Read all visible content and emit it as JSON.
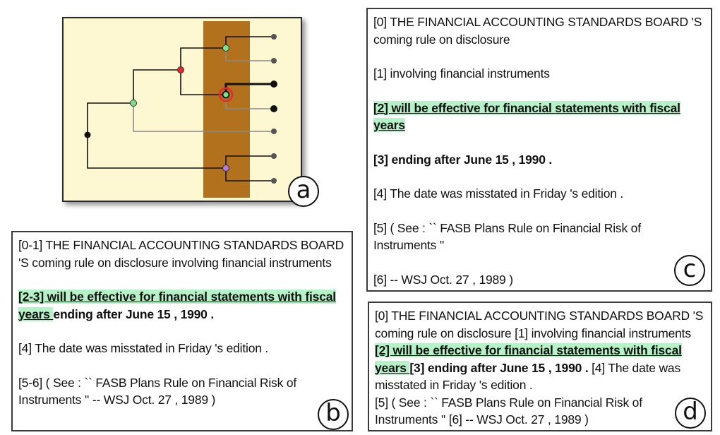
{
  "labels": {
    "a": "a",
    "b": "b",
    "c": "c",
    "d": "d"
  },
  "colors": {
    "panel_bg": "#fdf8d2",
    "band": "#b2711c",
    "highlight": "#b6f2c7",
    "node_red": "#e8262e",
    "node_green": "#7fe08a",
    "node_purple": "#b57ad6",
    "node_black": "#111111",
    "leaf_gray": "#555555"
  },
  "panel_b": {
    "s1": "[0-1] THE FINANCIAL ACCOUNTING STANDARDS BOARD 'S coming rule on disclosure  involving financial instruments",
    "s2_hl": "[2-3] will be effective for financial statements with fiscal years ",
    "s2_rest": "ending after June 15 , 1990 .",
    "s3": "[4] The date was misstated in Friday 's edition .",
    "s4": "[5-6] ( See : `` FASB Plans Rule on Financial Risk of Instruments '' -- WSJ Oct. 27 , 1989 )"
  },
  "panel_c": {
    "s0": "[0] THE FINANCIAL ACCOUNTING STANDARDS BOARD 'S coming rule on disclosure",
    "s1": "[1] involving financial instruments",
    "s2": "[2] will be effective for financial statements with fiscal years",
    "s3": "[3] ending after June 15 , 1990 .",
    "s4": "[4] The date was misstated in Friday 's edition .",
    "s5": "[5] ( See : `` FASB Plans Rule on Financial Risk of Instruments ''",
    "s6": "[6] -- WSJ Oct. 27 , 1989 )"
  },
  "panel_d": {
    "p0": "[0] THE FINANCIAL ACCOUNTING STANDARDS BOARD 'S coming rule on disclosure  ",
    "p1": "[1] involving financial instruments  ",
    "p2": "[2] will be effective for financial statements with fiscal years ",
    "p3": " [3] ending after June 15 , 1990 . ",
    "p4": " [4] The date was misstated in Friday 's edition .",
    "p5": "[5] ( See : `` FASB Plans Rule on Financial Risk of Instruments '' ",
    "p6": " [6] -- WSJ Oct. 27 , 1989 )"
  }
}
